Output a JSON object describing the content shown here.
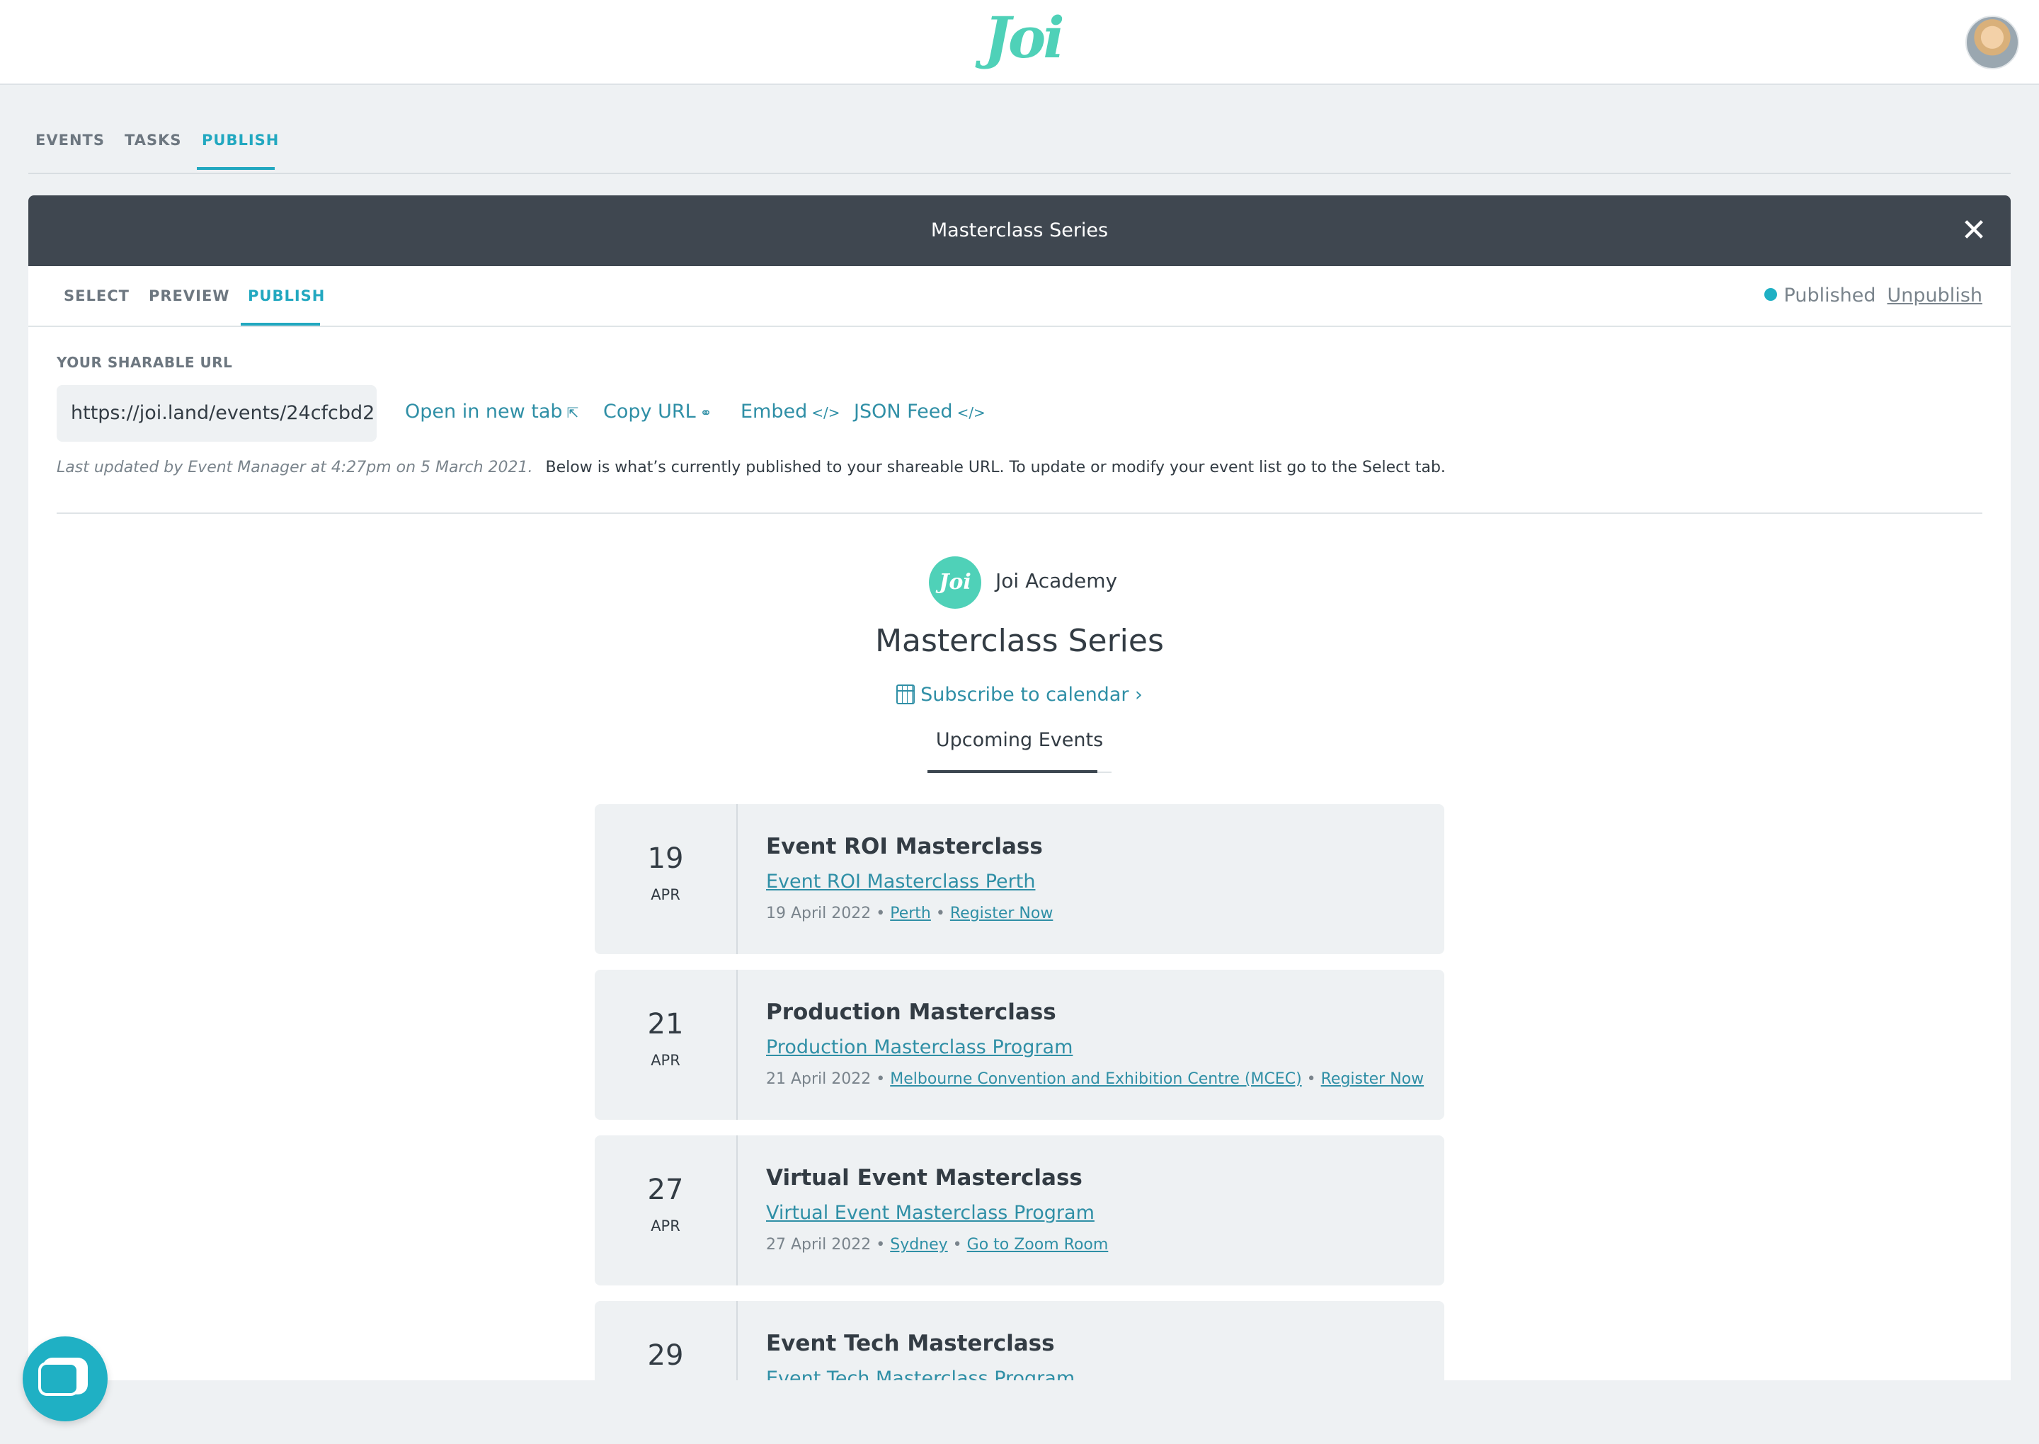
{
  "brand": {
    "logo_text": "Joi",
    "accent_color": "#22a8c0",
    "logo_color": "#4fd1b8"
  },
  "main_tabs": [
    {
      "label": "EVENTS"
    },
    {
      "label": "TASKS"
    },
    {
      "label": "PUBLISH",
      "active": true
    }
  ],
  "panel": {
    "title": "Masterclass Series",
    "close_icon": "close-icon",
    "tabs": [
      {
        "label": "SELECT"
      },
      {
        "label": "PREVIEW"
      },
      {
        "label": "PUBLISH",
        "active": true
      }
    ],
    "status": {
      "label": "Published",
      "action": "Unpublish"
    },
    "url_label": "YOUR SHARABLE URL",
    "url_value": "https://joi.land/events/24cfcbd2",
    "url_actions": [
      {
        "label": "Open in new tab",
        "icon": "external-link-icon"
      },
      {
        "label": "Copy URL",
        "icon": "link-icon"
      },
      {
        "label": "Embed",
        "icon": "code-icon"
      },
      {
        "label": "JSON Feed",
        "icon": "code-icon"
      }
    ],
    "last_updated": "Last updated by Event Manager at 4:27pm on 5 March 2021.",
    "info_text": "Below is what’s currently published to your shareable URL. To update or modify your event list go to the Select tab."
  },
  "preview": {
    "org_badge": "Joi",
    "org_name": "Joi Academy",
    "title": "Masterclass Series",
    "subscribe": "Subscribe to calendar ›",
    "list_tab": "Upcoming Events",
    "events": [
      {
        "day": "19",
        "month": "APR",
        "title": "Event ROI Masterclass",
        "program": "Event ROI Masterclass Perth",
        "date": "19 April 2022",
        "location": "Perth",
        "action": "Register Now"
      },
      {
        "day": "21",
        "month": "APR",
        "title": "Production Masterclass",
        "program": "Production Masterclass Program",
        "date": "21 April 2022",
        "location": "Melbourne Convention and Exhibition Centre (MCEC)",
        "action": "Register Now"
      },
      {
        "day": "27",
        "month": "APR",
        "title": "Virtual Event Masterclass",
        "program": "Virtual Event Masterclass Program",
        "date": "27 April 2022",
        "location": "Sydney",
        "action": "Go to Zoom Room"
      },
      {
        "day": "29",
        "month": "",
        "title": "Event Tech Masterclass",
        "program": "Event Tech Masterclass Program",
        "date": "",
        "location": "",
        "action": ""
      }
    ]
  }
}
